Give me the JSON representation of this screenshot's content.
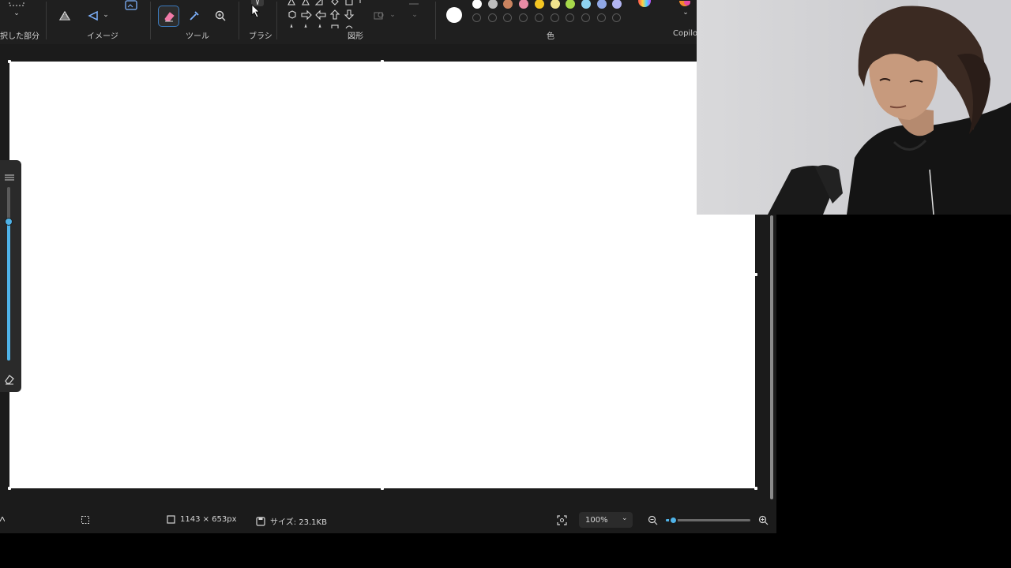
{
  "ribbon": {
    "groups": {
      "selection": "択した部分",
      "image": "イメージ",
      "tools": "ツール",
      "brush": "ブラシ",
      "shapes": "図形",
      "colors": "色",
      "copilot": "Copilot"
    }
  },
  "colors": {
    "top_row": [
      "#ffffff",
      "#bdbdbd",
      "#c9835f",
      "#e88ca5",
      "#f3c522",
      "#f1e38e",
      "#a6d84a",
      "#8fd3f0",
      "#90a8e6",
      "#b2b5f2"
    ],
    "current": "#ffffff"
  },
  "status": {
    "dimensions": "1143 × 653px",
    "size": "サイズ: 23.1KB",
    "zoom": "100%"
  },
  "zoom_slider": {
    "value_fraction": 0.07
  },
  "brush_size_slider": {
    "value_fraction": 0.8
  }
}
